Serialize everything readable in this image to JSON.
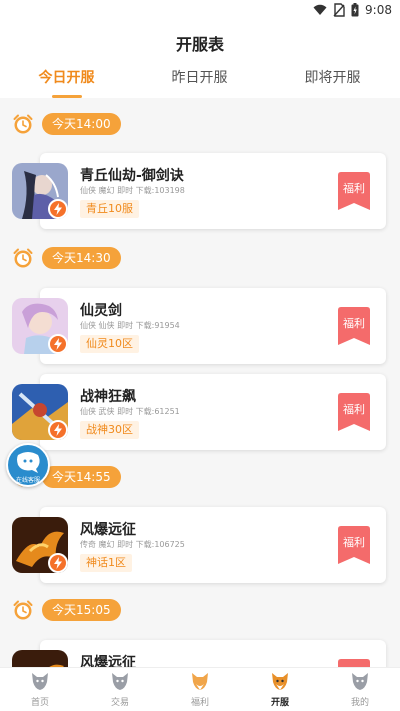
{
  "status_bar": {
    "time": "9:08",
    "icons": [
      "wifi-icon",
      "no-sim-icon",
      "battery-icon"
    ]
  },
  "header": {
    "title": "开服表"
  },
  "tabs": [
    {
      "label": "今日开服",
      "active": true
    },
    {
      "label": "昨日开服",
      "active": false
    },
    {
      "label": "即将开服",
      "active": false
    }
  ],
  "groups": [
    {
      "time": "今天14:00"
    },
    {
      "time": "今天14:30"
    },
    {
      "time": "今天14:55"
    },
    {
      "time": "今天15:05"
    }
  ],
  "games": [
    {
      "name": "青丘仙劫-御剑诀",
      "meta": "仙侠 魔幻 即时 下载:103198",
      "server": "青丘10服",
      "welfare": "福利"
    },
    {
      "name": "仙灵剑",
      "meta": "仙侠 仙侠 即时 下载:91954",
      "server": "仙灵10区",
      "welfare": "福利"
    },
    {
      "name": "战神狂飙",
      "meta": "仙侠 武侠 即时 下载:61251",
      "server": "战神30区",
      "welfare": "福利"
    },
    {
      "name": "风爆远征",
      "meta": "传奇 魔幻 即时 下载:106725",
      "server": "神话1区",
      "welfare": "福利"
    },
    {
      "name": "风爆远征"
    }
  ],
  "floating_service": {
    "label": "在线客服"
  },
  "tabbar": [
    {
      "label": "首页",
      "active": false
    },
    {
      "label": "交易",
      "active": false
    },
    {
      "label": "福利",
      "active": false
    },
    {
      "label": "开服",
      "active": true
    },
    {
      "label": "我的",
      "active": false
    }
  ],
  "colors": {
    "accent": "#f5a23a",
    "welfare": "#f46b6b",
    "tag_bg": "#fff2e3"
  }
}
